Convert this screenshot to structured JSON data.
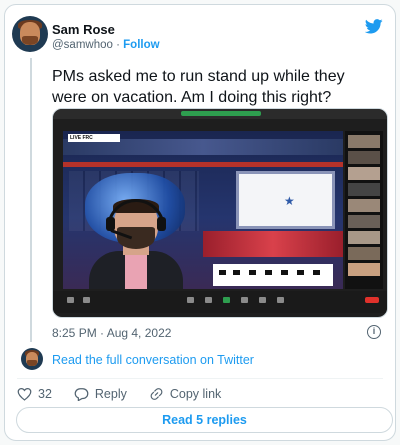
{
  "author": {
    "name": "Sam Rose",
    "handle": "@samwhoo",
    "separator": "·",
    "follow_label": "Follow"
  },
  "tweet": {
    "text": "PMs asked me to run stand up while they were on vacation. Am I doing this right?",
    "timestamp": "8:25 PM · Aug 4, 2022"
  },
  "media": {
    "live_tag": "LIVE FRC"
  },
  "conversation": {
    "link_label": "Read the full conversation on Twitter"
  },
  "actions": {
    "like_count": "32",
    "reply_label": "Reply",
    "copy_label": "Copy link"
  },
  "read_replies_label": "Read 5 replies",
  "colors": {
    "accent": "#1d9bf0",
    "muted": "#536471",
    "border": "#cfd9de"
  },
  "icons": [
    "twitter-bird-icon",
    "info-icon",
    "heart-icon",
    "reply-icon",
    "link-icon"
  ]
}
